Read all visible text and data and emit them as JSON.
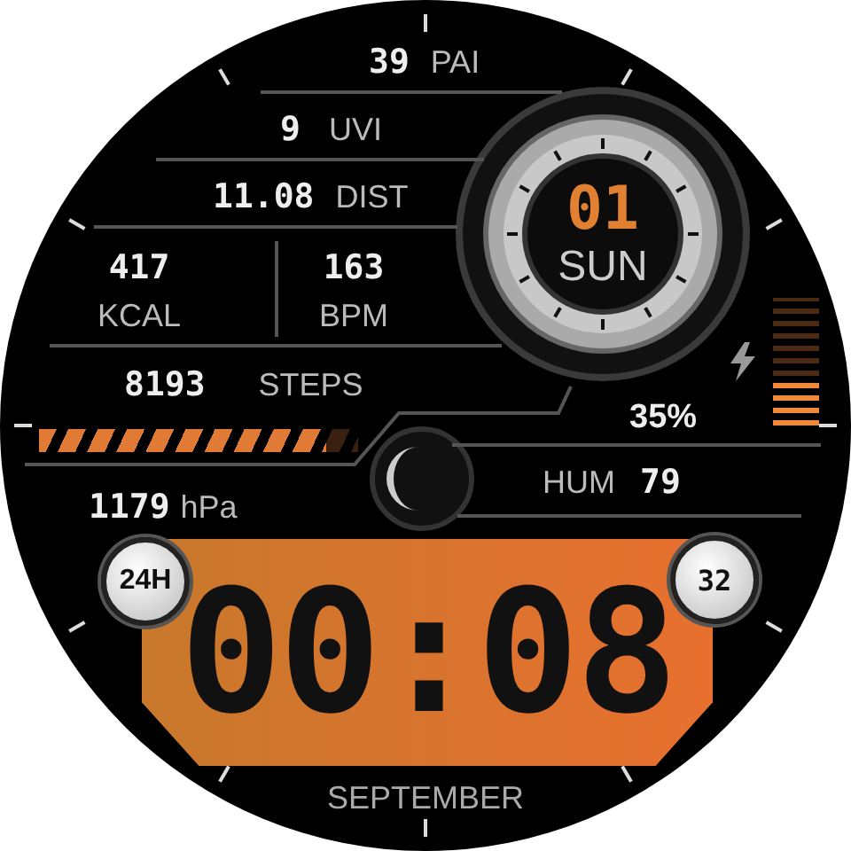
{
  "pai": {
    "value": "39",
    "label": "PAI"
  },
  "uvi": {
    "value": "9",
    "label": "UVI"
  },
  "distance": {
    "value": "11.08",
    "label": "DIST"
  },
  "calories": {
    "value": "417",
    "label": "KCAL"
  },
  "heart_rate": {
    "value": "163",
    "label": "BPM"
  },
  "steps": {
    "value": "8193",
    "label": "STEPS",
    "level": 0.9
  },
  "date": {
    "day": "01",
    "weekday": "SUN"
  },
  "battery": {
    "reading": "35%",
    "level": 0.35,
    "charging": true
  },
  "humidity": {
    "label": "HUM",
    "value": "79"
  },
  "pressure": {
    "value": "1179",
    "unit": "hPa"
  },
  "time": {
    "value": "00:08",
    "format_badge": "24H",
    "seconds": "32"
  },
  "month": "SEPTEMBER"
}
